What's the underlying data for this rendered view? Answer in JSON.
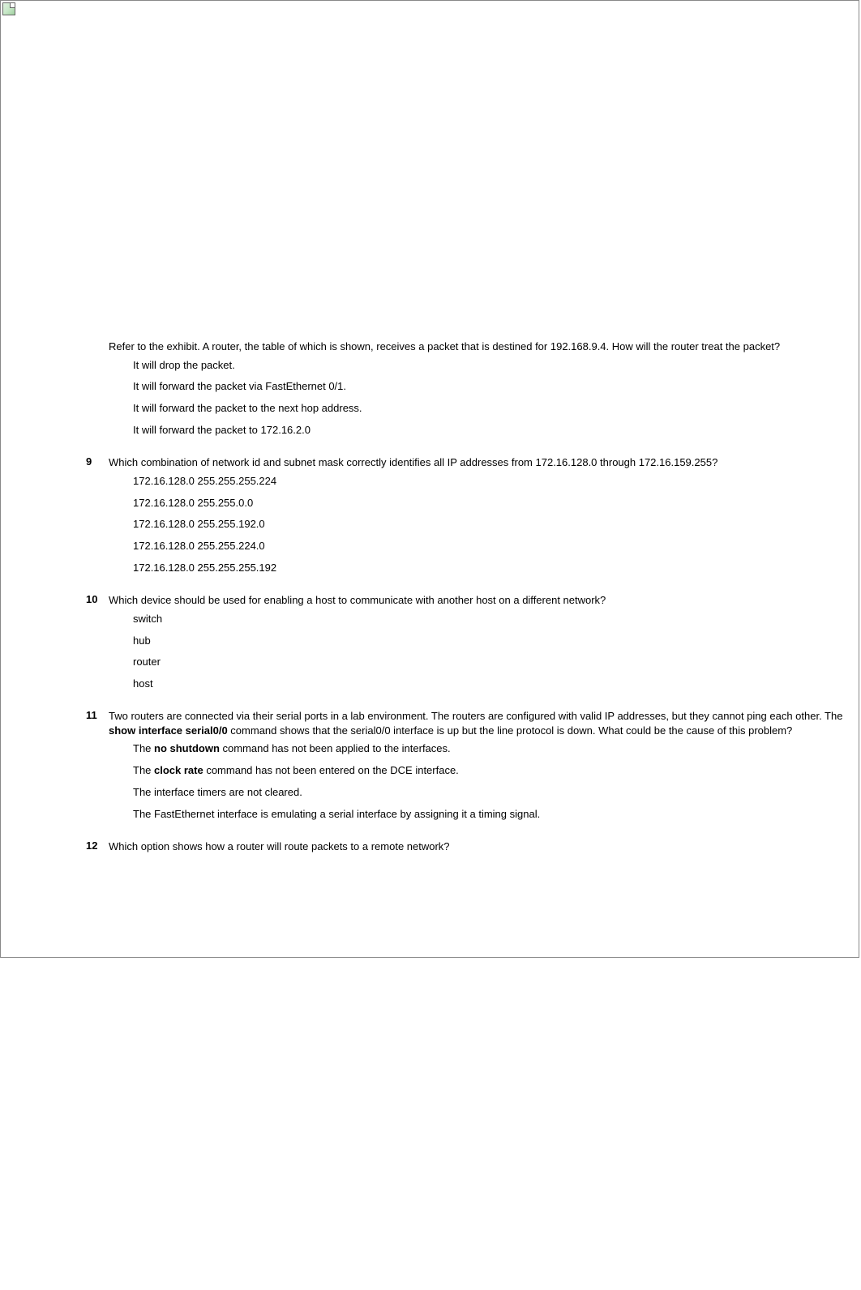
{
  "questions": [
    {
      "number": "",
      "text": "Refer to the exhibit. A router, the table of which is shown, receives a packet that is destined for 192.168.9.4. How will the router treat the packet?",
      "options": [
        {
          "text": "It will drop the packet."
        },
        {
          "text": "It will forward the packet via FastEthernet 0/1."
        },
        {
          "text": "It will forward the packet to the next hop address."
        },
        {
          "text": "It will forward the packet to 172.16.2.0"
        }
      ]
    },
    {
      "number": "9",
      "text": "Which combination of network id and subnet mask correctly identifies all IP addresses from 172.16.128.0 through 172.16.159.255?",
      "options": [
        {
          "text": "172.16.128.0 255.255.255.224"
        },
        {
          "text": "172.16.128.0 255.255.0.0"
        },
        {
          "text": "172.16.128.0 255.255.192.0"
        },
        {
          "text": "172.16.128.0 255.255.224.0"
        },
        {
          "text": "172.16.128.0 255.255.255.192"
        }
      ]
    },
    {
      "number": "10",
      "text": "Which device should be used for enabling a host to communicate with another host on a different network?",
      "options": [
        {
          "text": "switch"
        },
        {
          "text": "hub"
        },
        {
          "text": "router"
        },
        {
          "text": "host"
        }
      ]
    },
    {
      "number": "11",
      "text_parts": {
        "p1": "Two routers are connected via their serial ports in a lab environment. The routers are configured with valid IP addresses, but they cannot ping each other. The ",
        "b1": "show interface serial0/0",
        "p2": " command shows that the serial0/0 interface is up but the line protocol is down. What could be the cause of this problem?"
      },
      "options_rich": [
        {
          "p1": "The ",
          "b1": "no shutdown",
          "p2": " command has not been applied to the interfaces."
        },
        {
          "p1": "The ",
          "b1": "clock rate",
          "p2": " command has not been entered on the DCE interface."
        },
        {
          "p1": "The interface timers are not cleared."
        },
        {
          "p1": "The FastEthernet interface is emulating a serial interface by assigning it a timing signal."
        }
      ]
    },
    {
      "number": "12",
      "text": "Which option shows how a router will route packets to a remote network?",
      "options": []
    }
  ]
}
